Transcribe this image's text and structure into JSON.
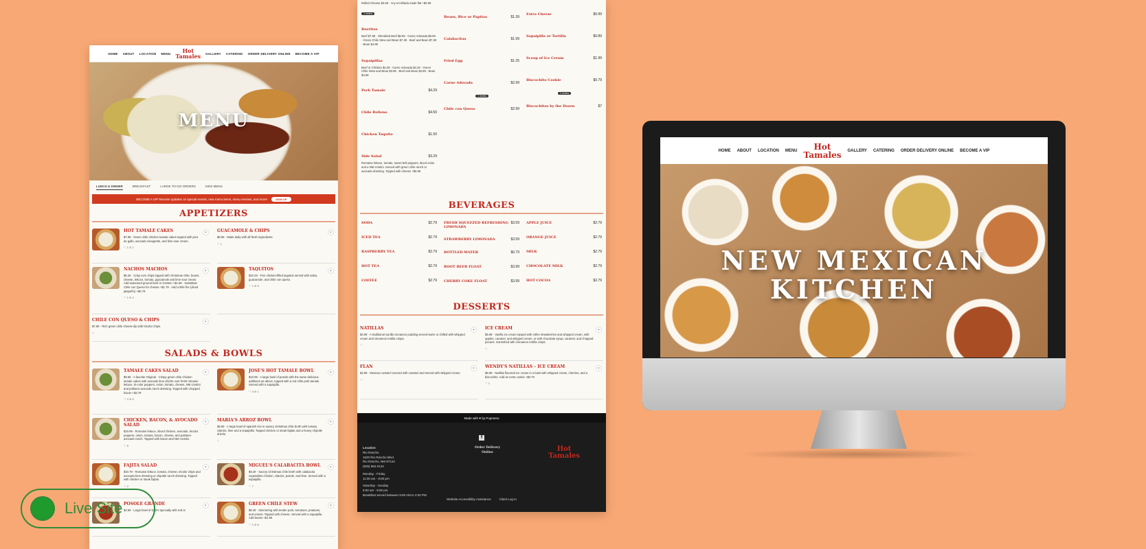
{
  "nav": {
    "items_left": [
      "HOME",
      "ABOUT",
      "LOCATION",
      "MENU"
    ],
    "items_right": [
      "GALLERY",
      "CATERING",
      "ORDER DELIVERY ONLINE",
      "BECOME A VIP"
    ],
    "logo_line1": "Hot",
    "logo_line2": "Tamales"
  },
  "menu_page": {
    "hero_title": "MENU",
    "tabs": [
      "LUNCH & DINNER",
      "BREAKFAST",
      "LARGE TO-GO ORDERS",
      "KIDS MENU"
    ],
    "vip_text": "BECOME A VIP  Receive updates on special events, new menu items, menu reviews, and more!",
    "vip_button": "SIGN UP",
    "appetizers_title": "APPETIZERS",
    "appetizers": [
      {
        "name": "HOT TAMALE CAKES",
        "desc": "$7.99 · Green chile chicken tamale cakes topped with pico de gallo, avocado vinaigrette, and lime sour cream.",
        "meta": "♡ 1   ⊘ 2"
      },
      {
        "name": "GUACAMOLE & CHIPS",
        "desc": "$8.59 · Made daily with all fresh ingredients",
        "meta": "♡ 1"
      },
      {
        "name": "NACHOS MACHOS",
        "desc": "$5.25 · Crisp corn chips topped with christmas chile, beans, cheese, lettuce, tomato, guacamole and lime sour cream. Add seasoned ground beef or chicken +$1.99 · Substitute Chile con Queso for cheese +$1.79 · Add a little fire (diced jalapeño) +$0.79",
        "meta": "♡ 1   ⊘ 4"
      },
      {
        "name": "TAQUITOS",
        "desc": "$10.29 · Five chicken-filled taquitos served with salsa, guacamole, and chile con queso.",
        "meta": "♡ 1   ⊘ 5"
      },
      {
        "name": "CHILE CON QUESO & CHIPS",
        "desc": "$7.99 · Rich green chile cheese dip with tricolor chips.",
        "meta": "♡"
      }
    ],
    "salads_title": "SALADS & BOWLS",
    "salads": [
      {
        "name": "TAMALE CAKES SALAD",
        "desc": "$9.95 · A favorite Original · Crispy green chile chicken tamale cakes with avocado lime drizzle over fresh romaine lettuce, tri-color peppers, onion, tomato, cheese, NM crostini and poblano-avocado ranch dressing. Topped with chopped bacon +$2.79",
        "meta": "♡ 2   ⊘ 5"
      },
      {
        "name": "JOSE'S HOT TAMALE BOWL",
        "desc": "$10.99 · A large bowl of posole with the same delicious additions as above, topped with a red chile pork tamale. Served with a sopaipilla.",
        "meta": "♡ 4   ⊘ 1"
      },
      {
        "name": "MARIA'S ARROZ BOWL",
        "desc": "$9.59 · A large bowl of spanish rice in savory christmas chile broth with tomato, cilantro, lime and a sopaipilla. Topped chicken or steak fajitas and a honey chipotle drizzle.",
        "meta": "♡"
      },
      {
        "name": "CHICKEN, BACON, & AVOCADO SALAD",
        "desc": "$10.99 · Romaine lettuce, sliced chicken, avocado, tricolor peppers, onion, tomato, bacon, cheese, and poblano-avocado ranch. Topped with bacon and NM crostini.",
        "meta": "♡ 6"
      },
      {
        "name": "MIGUEL'S CALABACITA BOWL",
        "desc": "$9.29 · Savory Christmas chile broth with calabacita vegetables chicken, cilantro, posole, and lime. Served with a sopaipilla.",
        "meta": "♡ 7"
      },
      {
        "name": "FAJITA SALAD",
        "desc": "$10.79 · Romaine lettuce, tomato, cheese, tricolor chips and avocado-lime dressing or chipotle ranch dressing. Topped with chicken or steak fajitas.",
        "meta": "♡ 2"
      },
      {
        "name": "GREEN CHILE STEW",
        "desc": "$9.49 · Simmering with tender pork, tomatoes, potatoes, and onions. Topped with cheese. Served with a sopaipilla. Add beans +$1.99",
        "meta": "♡ 1   ⊘ 8"
      },
      {
        "name": "POSOLE GRANDE",
        "desc": "$4.59 · Large bowl of Dad's Specialty with red or",
        "meta": ""
      }
    ]
  },
  "menu_page_2": {
    "col1": [
      {
        "name": "",
        "price": "",
        "desc": "Rolled Cheese $3.69 · Any enchilada made flat +$0.59",
        "badge": "1 review"
      },
      {
        "name": "Burritos",
        "price": "",
        "desc": "Beef $7.69 · Shredded Beef $8.69 · Carne Adovada $8.69 · Green Chile Stew and Bean $7.39 · Beef and Bean $7.39 · Bean $4.89",
        "badge": ""
      },
      {
        "name": "Sopaipillas",
        "price": "",
        "desc": "Beef or Chicken $4.09 · Carne Adovada $4.29 · Green Chile Stew and Bean $3.99 · Beef and Bean $3.89 · Bean $3.69",
        "badge": ""
      },
      {
        "name": "Pork Tamale",
        "price": "$4.29",
        "desc": "",
        "badge": ""
      },
      {
        "name": "Chile Relleno",
        "price": "$4.50",
        "desc": "",
        "badge": ""
      },
      {
        "name": "Chicken Taquito",
        "price": "$1.50",
        "desc": "",
        "badge": ""
      },
      {
        "name": "Side Salad",
        "price": "$3.29",
        "desc": "Romaine lettuce, tomato, sweet bell peppers, diced onion and a NM crostini. Served with green chile ranch or avocado dressing. Topped with cheese +$0.99",
        "badge": ""
      }
    ],
    "col2": [
      {
        "name": "Beans, Rice or Papitas",
        "price": "$1.39",
        "badge": ""
      },
      {
        "name": "Calabacitas",
        "price": "$1.99",
        "badge": ""
      },
      {
        "name": "Fried Egg",
        "price": "$1.25",
        "badge": ""
      },
      {
        "name": "Carne Adovada",
        "price": "$2.99",
        "badge": "1 review"
      },
      {
        "name": "Chile con Queso",
        "price": "$2.99",
        "badge": ""
      }
    ],
    "col3": [
      {
        "name": "Extra Cheese",
        "price": "$0.99",
        "badge": ""
      },
      {
        "name": "Sopaipilla or Tortilla",
        "price": "$0.89",
        "badge": ""
      },
      {
        "name": "Scoop of Ice Cream",
        "price": "$1.99",
        "badge": ""
      },
      {
        "name": "Biscochito Cookie",
        "price": "$0.79",
        "badge": "1 review"
      },
      {
        "name": "Biscochitos by the Dozen",
        "price": "$7",
        "badge": ""
      }
    ],
    "beverages_title": "BEVERAGES",
    "beverages": [
      [
        {
          "name": "SODA",
          "price": "$2.79"
        },
        {
          "name": "ICED TEA",
          "price": "$2.79"
        },
        {
          "name": "RASPBERRY TEA",
          "price": "$2.79"
        },
        {
          "name": "HOT TEA",
          "price": "$2.79"
        },
        {
          "name": "COFFEE",
          "price": "$2.79"
        }
      ],
      [
        {
          "name": "FRESH SQUEEZED REFRESHING LIMONADA",
          "price": "$3.59"
        },
        {
          "name": "STRAWBERRY LIMONADA",
          "price": "$3.59"
        },
        {
          "name": "BOTTLED WATER",
          "price": "$0.79"
        },
        {
          "name": "ROOT BEER FLOAT",
          "price": "$3.99"
        },
        {
          "name": "CHERRY COKE FLOAT",
          "price": "$3.99"
        }
      ],
      [
        {
          "name": "APPLE JUICE",
          "price": "$2.79"
        },
        {
          "name": "ORANGE JUICE",
          "price": "$2.79"
        },
        {
          "name": "MILK",
          "price": "$2.79"
        },
        {
          "name": "CHOCOLATE MILK",
          "price": "$2.79"
        },
        {
          "name": "HOT COCOA",
          "price": "$2.79"
        }
      ]
    ],
    "desserts_title": "DESSERTS",
    "desserts": [
      {
        "name": "NATILLAS",
        "desc": "$3.99 · A traditional vanilla cinnamon pudding served warm or chilled with whipped cream and cinnamon tortilla crisps.",
        "meta": "♡"
      },
      {
        "name": "ICE CREAM",
        "desc": "$5.99 · Vanilla ice cream topped with either strawberries and whipped cream, with apples, caramel, and whipped cream, or with chocolate syrup, caramel, and chopped pecans. Garnished with cinnamon tortilla crisps.",
        "meta": "♡"
      },
      {
        "name": "FLAN",
        "desc": "$4.99 · Mexican custard covered with caramel and served with whipped cream.",
        "meta": "♡"
      },
      {
        "name": "WENDY'S NATILLAS – ICE CREAM",
        "desc": "$5.99 · Natillas flavored ice cream in a bowl with whipped cream, cherries, and a biscochito. Add an extra cookie +$0.79",
        "meta": "♡ 1"
      }
    ],
    "made_with": "Made with ♥ by Popmenu",
    "footer": {
      "location_label": "Location",
      "location_name": "Rio Rancho",
      "address1": "1520 Rio Rancho Blvd.",
      "address2": "Rio Rancho, NM 87124",
      "phone": "(505) 962-0123",
      "hours1": "Monday - Friday",
      "hours1_time": "11:00 am - 8:00 pm",
      "hours2": "Saturday - Sunday",
      "hours2_time": "9:00 am - 8:00 pm",
      "breakfast": "Breakfast served between 9:00 AM to 2:00 PM",
      "order_label": "Order Delivery Online",
      "accessibility": "Website Accessibility Assistance",
      "client_login": "Client Log In"
    }
  },
  "home_page": {
    "hero_title": "NEW MEXICAN\nKITCHEN"
  },
  "live_site": {
    "label": "Live Site",
    "accent": "#2e8b3a"
  }
}
